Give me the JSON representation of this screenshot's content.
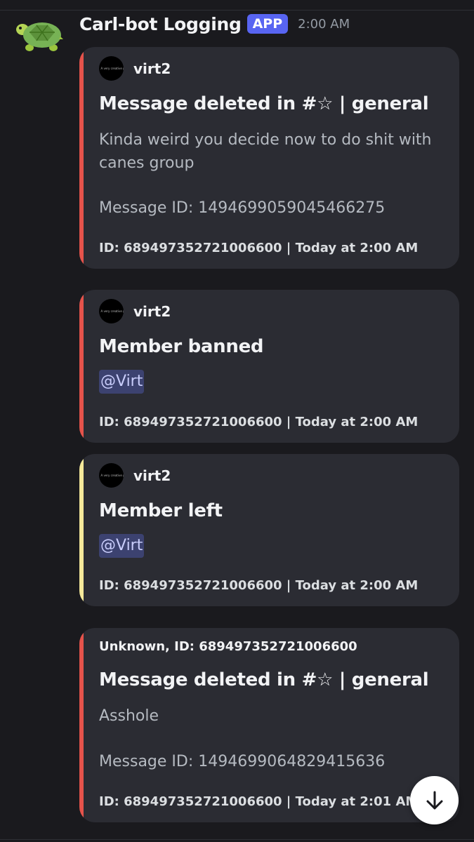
{
  "message": {
    "author": "Carl-bot Logging",
    "badge": "APP",
    "timestamp": "2:00 AM",
    "avatar_icon": "turtle-icon"
  },
  "embeds": [
    {
      "accent_color": "#e5534b",
      "author_name": "virt2",
      "author_avatar_text": "A very creative pfp",
      "title": "Message deleted in #☆ | general",
      "content": "Kinda weird you decide now to do shit with canes group",
      "message_id": "Message ID: 1494699059045466275",
      "footer": "ID: 689497352721006600 | Today at 2:00 AM"
    },
    {
      "accent_color": "#e5534b",
      "author_name": "virt2",
      "author_avatar_text": "A very creative pfp",
      "title": "Member banned",
      "mention": "@Virt",
      "footer": "ID: 689497352721006600 | Today at 2:00 AM"
    },
    {
      "accent_color": "#f5e99a",
      "author_name": "virt2",
      "author_avatar_text": "A very creative pfp",
      "title": "Member left",
      "mention": "@Virt",
      "footer": "ID: 689497352721006600 | Today at 2:00 AM"
    },
    {
      "accent_color": "#e5534b",
      "author_name": "Unknown, ID: 689497352721006600",
      "title": "Message deleted in #☆ | general",
      "content": "Asshole",
      "message_id": "Message ID: 1494699064829415636",
      "footer": "ID: 689497352721006600 | Today at 2:01 AM"
    }
  ],
  "scroll_button": {
    "icon": "arrow-down-icon"
  }
}
